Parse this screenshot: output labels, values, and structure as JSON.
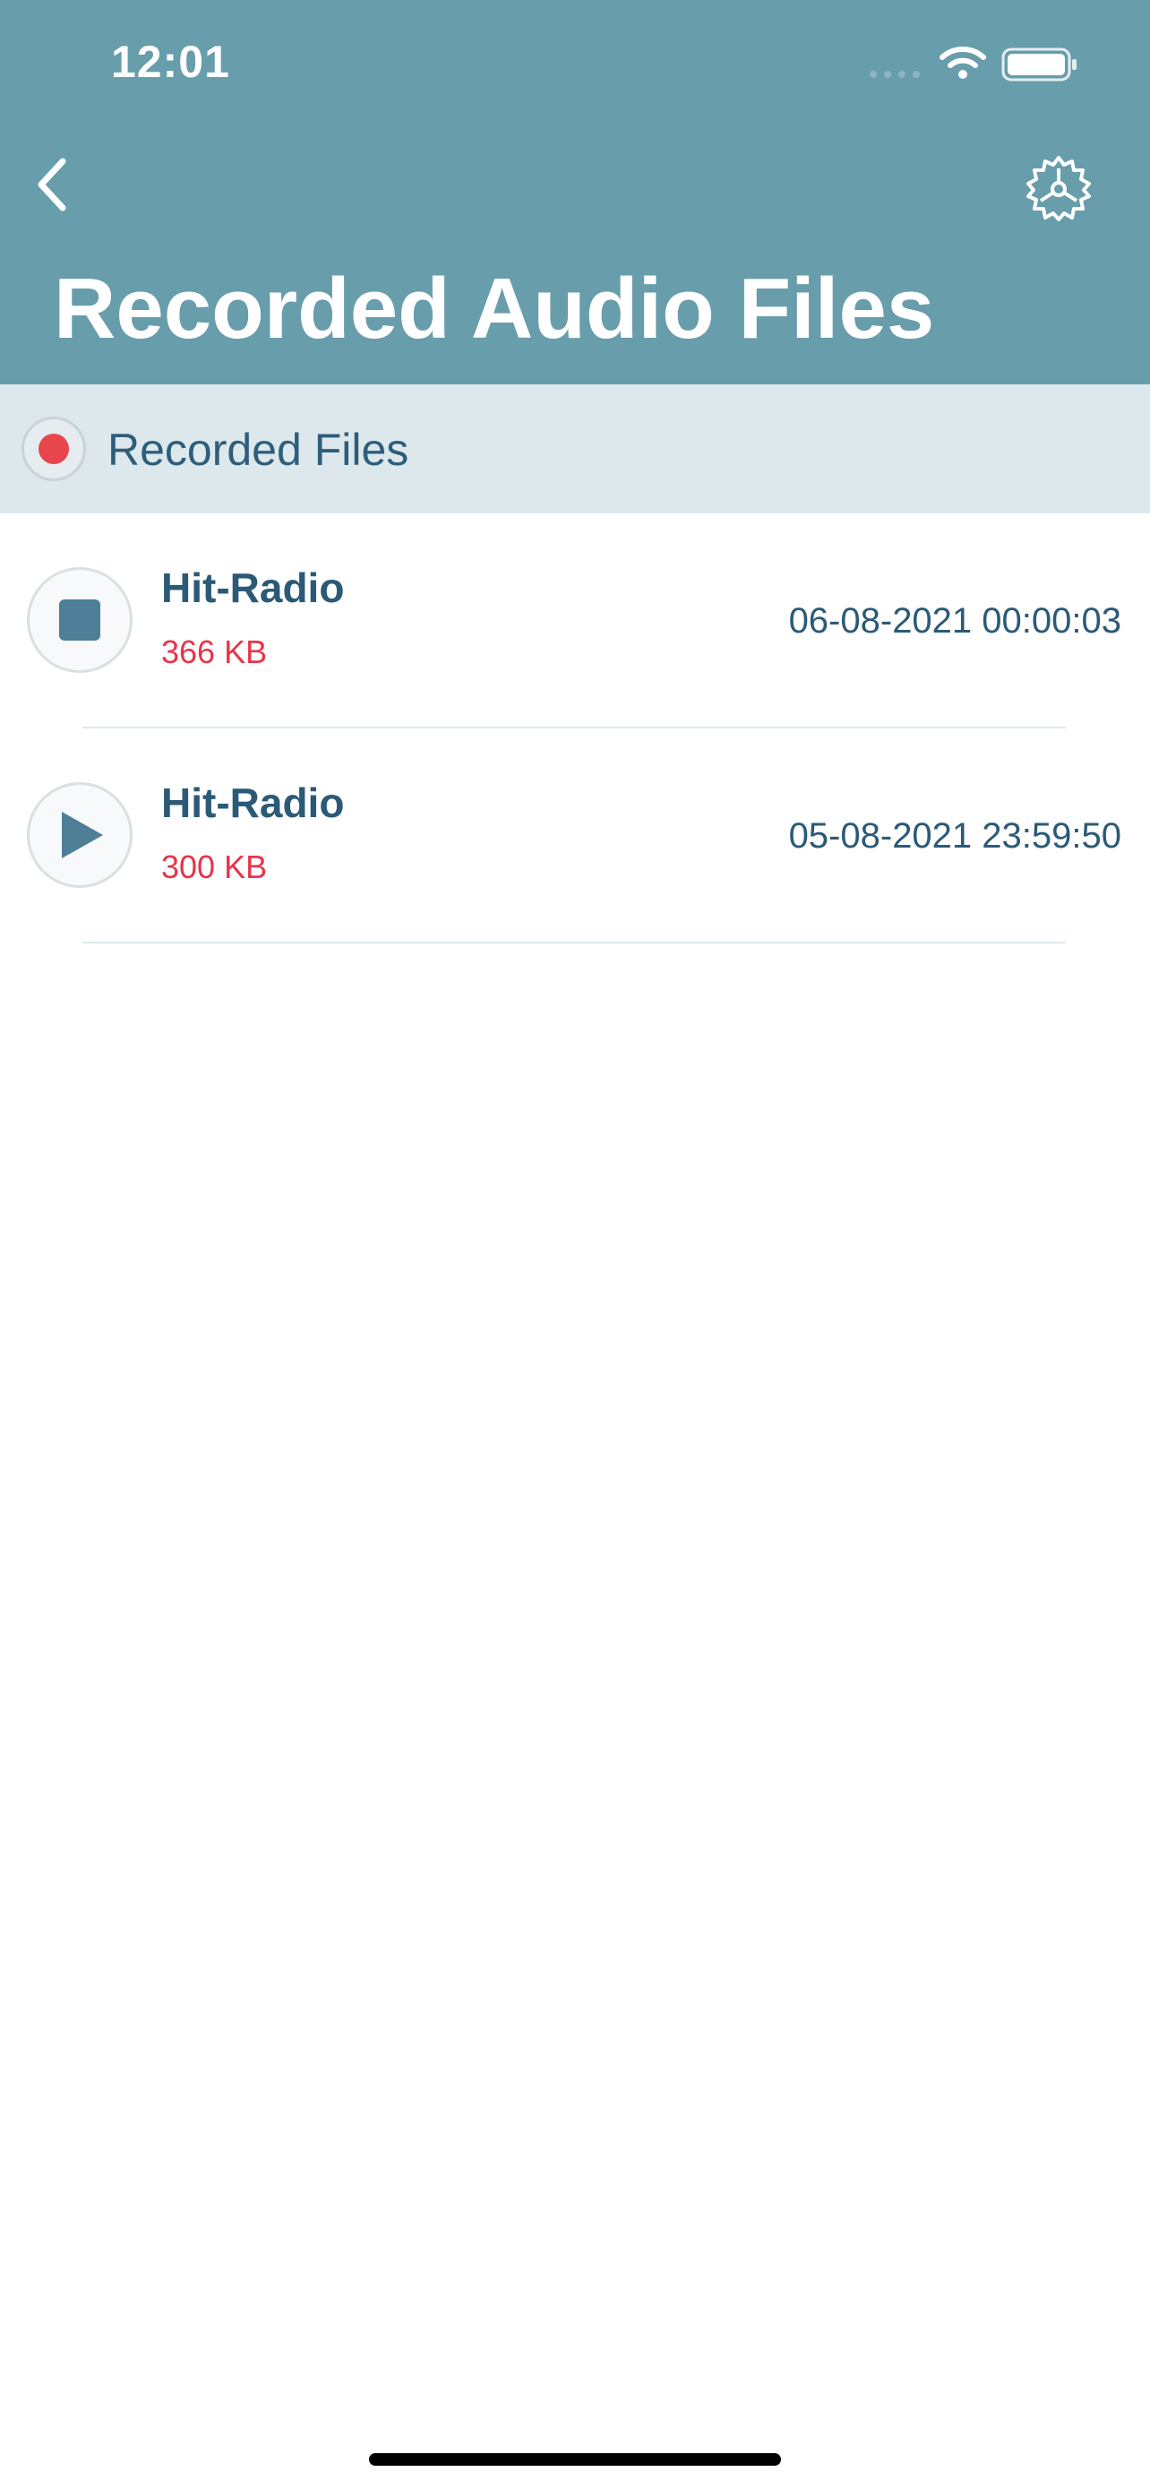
{
  "status_bar": {
    "time": "12:01"
  },
  "header": {
    "title": "Recorded Audio Files",
    "back_icon": "chevron-left-icon",
    "settings_icon": "gear-icon",
    "background_color": "#689dab"
  },
  "section": {
    "label": "Recorded Files",
    "indicator_color": "#e8454d"
  },
  "recordings": [
    {
      "title": "Hit-Radio",
      "size": "366 KB",
      "date": "06-08-2021 00:00:03",
      "state": "playing",
      "control_icon": "stop-icon"
    },
    {
      "title": "Hit-Radio",
      "size": "300 KB",
      "date": "05-08-2021 23:59:50",
      "state": "stopped",
      "control_icon": "play-icon"
    }
  ],
  "colors": {
    "accent": "#689dab",
    "title_text": "#2b5a77",
    "size_text": "#e8344a"
  }
}
